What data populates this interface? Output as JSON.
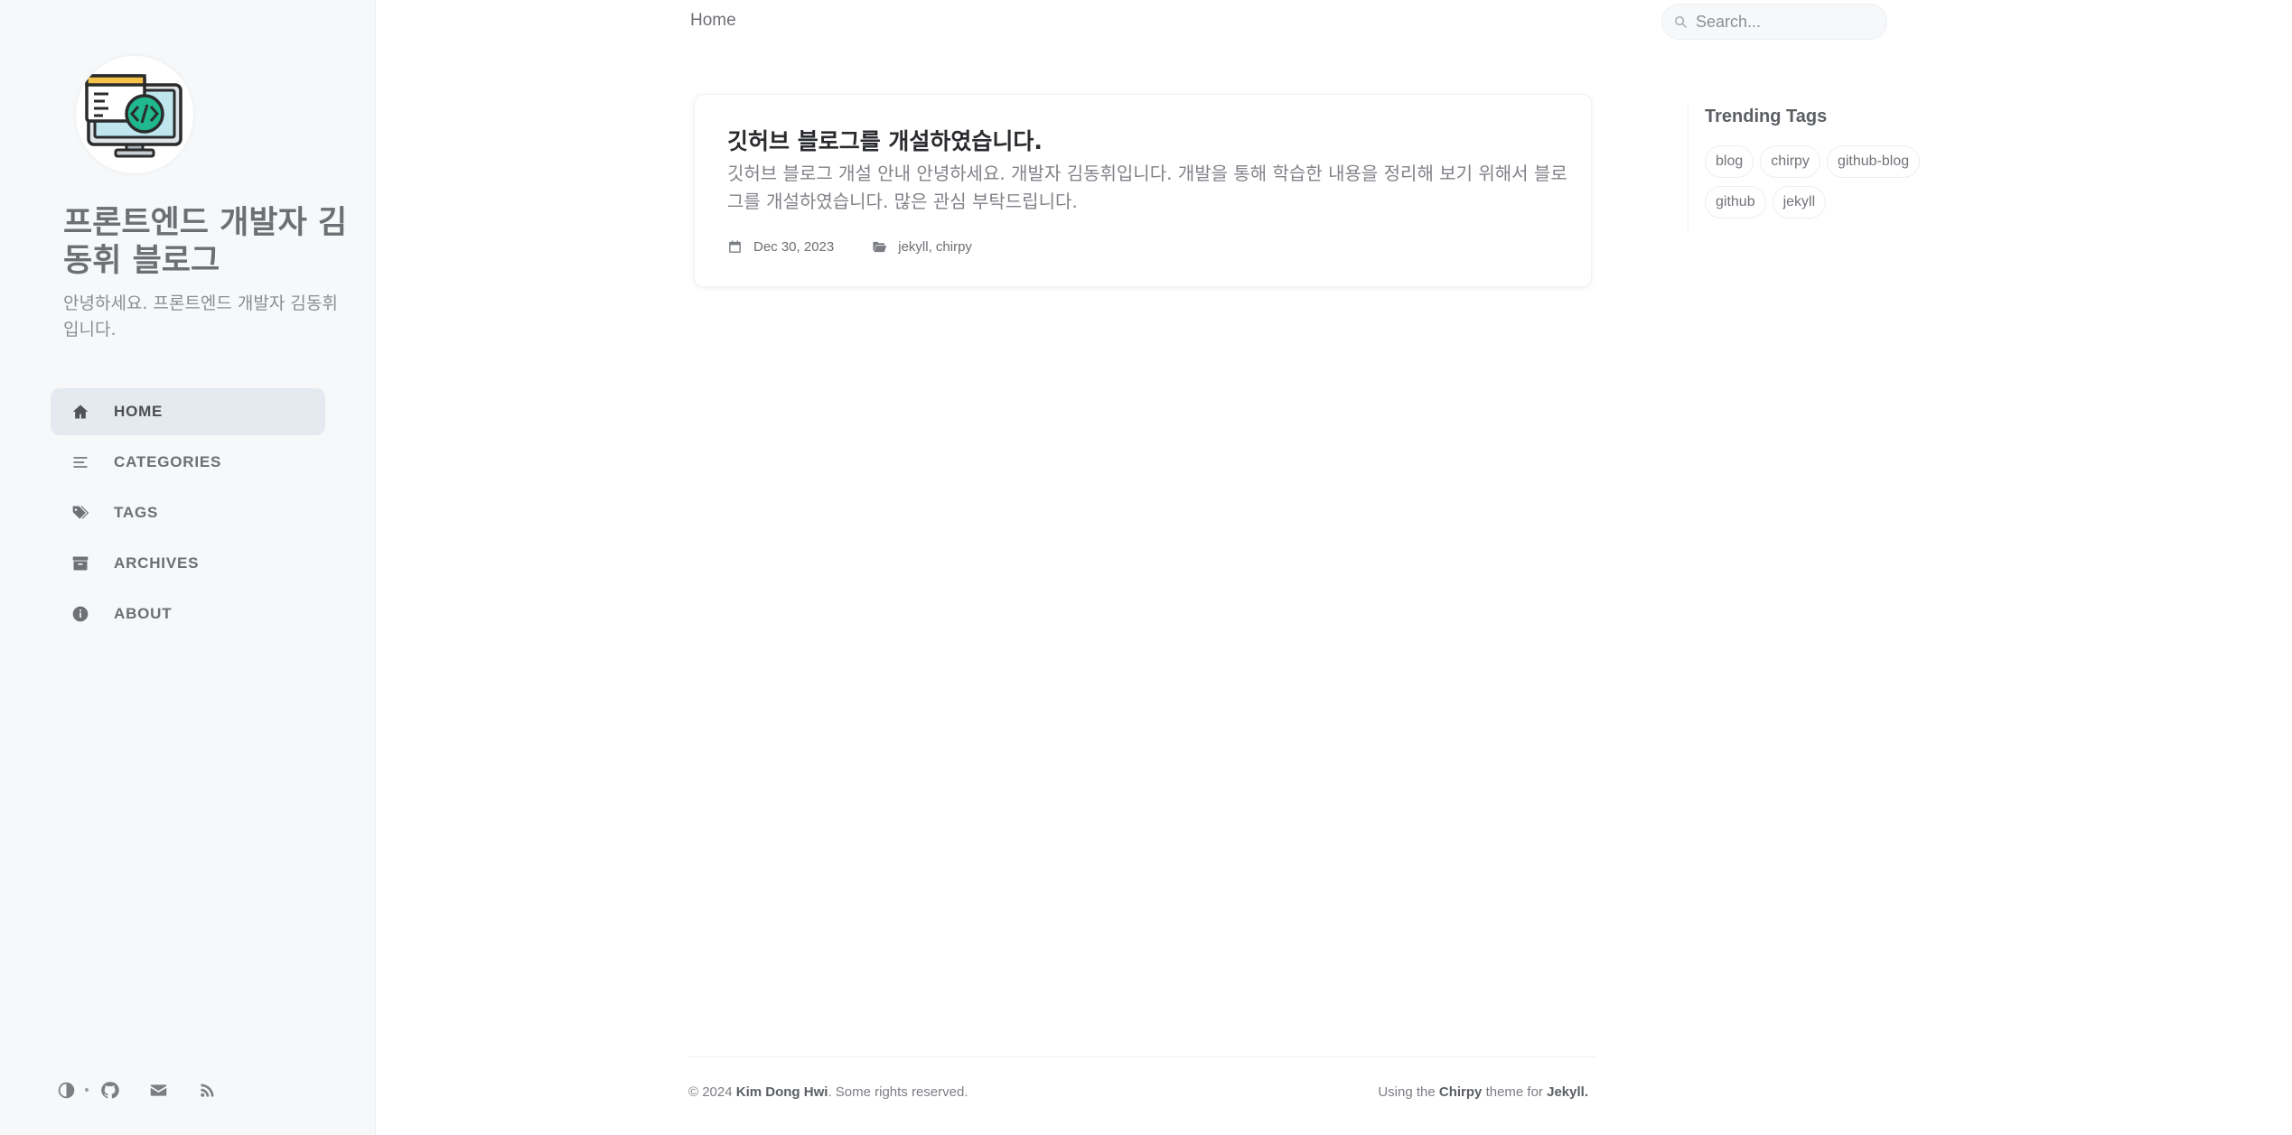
{
  "sidebar": {
    "site_title": "프론트엔드 개발자 김동휘 블로그",
    "site_subtitle": "안녕하세요. 프론트엔드 개발자 김동휘입니다.",
    "nav": [
      {
        "label": "HOME",
        "icon": "home-icon",
        "active": true
      },
      {
        "label": "CATEGORIES",
        "icon": "list-icon",
        "active": false
      },
      {
        "label": "TAGS",
        "icon": "tags-icon",
        "active": false
      },
      {
        "label": "ARCHIVES",
        "icon": "archive-icon",
        "active": false
      },
      {
        "label": "ABOUT",
        "icon": "info-icon",
        "active": false
      }
    ],
    "bottom_icons": [
      "theme-toggle-icon",
      "github-icon",
      "email-icon",
      "rss-icon"
    ]
  },
  "topbar": {
    "breadcrumb": "Home",
    "search_placeholder": "Search..."
  },
  "post": {
    "title": "깃허브 블로그를 개설하였습니다.",
    "excerpt": "깃허브 블로그 개설 안내 안녕하세요. 개발자 김동휘입니다. 개발을 통해 학습한 내용을 정리해 보기 위해서 블로그를 개설하였습니다. 많은 관심 부탁드립니다.",
    "date": "Dec 30, 2023",
    "categories": "jekyll, chirpy"
  },
  "trending": {
    "heading": "Trending Tags",
    "tags": [
      "blog",
      "chirpy",
      "github-blog",
      "github",
      "jekyll"
    ]
  },
  "footer": {
    "copyright_prefix": "© 2024",
    "author": "Kim Dong Hwi",
    "rights": ". Some rights reserved.",
    "using_prefix": "Using the",
    "theme_name": "Chirpy",
    "theme_mid": "theme for",
    "engine": "Jekyll",
    "period": "."
  },
  "colors": {
    "sidebar_bg": "#f6f8fa",
    "nav_active_bg": "#e5eaf1",
    "text_main": "#34343c",
    "text_muted": "#6c6f73"
  }
}
